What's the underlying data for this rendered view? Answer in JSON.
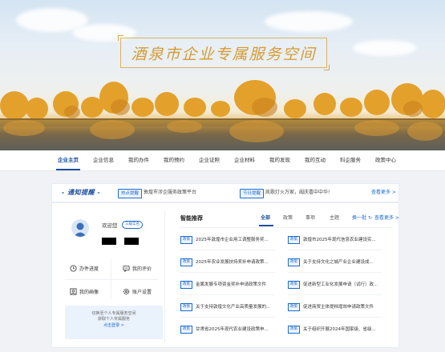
{
  "banner": {
    "title": "酒泉市企业专属服务空间"
  },
  "nav": {
    "items": [
      "企业主页",
      "企业信息",
      "我的办件",
      "我的预约",
      "企业证照",
      "企业材料",
      "我的发现",
      "我的互动",
      "科企服务",
      "政策中心"
    ],
    "active_index": 0
  },
  "notice": {
    "title": "- 通知提醒 -",
    "items": [
      {
        "tag": "热点提醒",
        "text": "敦煌市涉企服务政策平台"
      },
      {
        "tag": "节日提醒",
        "text": "凯歌灯火万家，阖庆喜中中华!"
      }
    ],
    "more": "查看更多 >"
  },
  "user": {
    "welcome": "欢迎您",
    "badge": "三级实名",
    "functions": [
      {
        "icon": "clock-icon",
        "label": "办件进度"
      },
      {
        "icon": "comment-icon",
        "label": "我的评价"
      },
      {
        "icon": "portrait-icon",
        "label": "我的画像"
      },
      {
        "icon": "settings-icon",
        "label": "账户设置"
      }
    ],
    "switch_line1": "切换至个人专属服务空间",
    "switch_line2": "获取个人专属服务",
    "switch_link": "点击登录 >"
  },
  "recommend": {
    "title": "智能推荐",
    "tabs": [
      "全部",
      "政策",
      "事项",
      "主题"
    ],
    "active_tab": 0,
    "refresh": "换一批",
    "more": "查看更多 >",
    "policies": [
      {
        "tag": "政策",
        "text": "2025年敦煌市企业用工调整服务奖..."
      },
      {
        "tag": "政策",
        "text": "敦煌市2025年现代信息农业建设实..."
      },
      {
        "tag": "政策",
        "text": "2025年农业发展扶持奖补申请政策..."
      },
      {
        "tag": "政策",
        "text": "关于支持文化之城产业企业建设成..."
      },
      {
        "tag": "政策",
        "text": "金属发展专项资金奖补申请政策文件"
      },
      {
        "tag": "政策",
        "text": "促进新型工业化发展申请（试行）政..."
      },
      {
        "tag": "政策",
        "text": "关于支持敦煌文化产业高质量发展的..."
      },
      {
        "tag": "政策",
        "text": "促进商贸主体提档增效申请政策文件"
      },
      {
        "tag": "政策",
        "text": "甘肃省2025年现代农业建设政策申..."
      },
      {
        "tag": "政策",
        "text": "关于组织开展2024年国家级、省级..."
      }
    ]
  },
  "colors": {
    "accent": "#1a4fa0",
    "link": "#1a6ad1",
    "title_gold": "#d69a32"
  }
}
